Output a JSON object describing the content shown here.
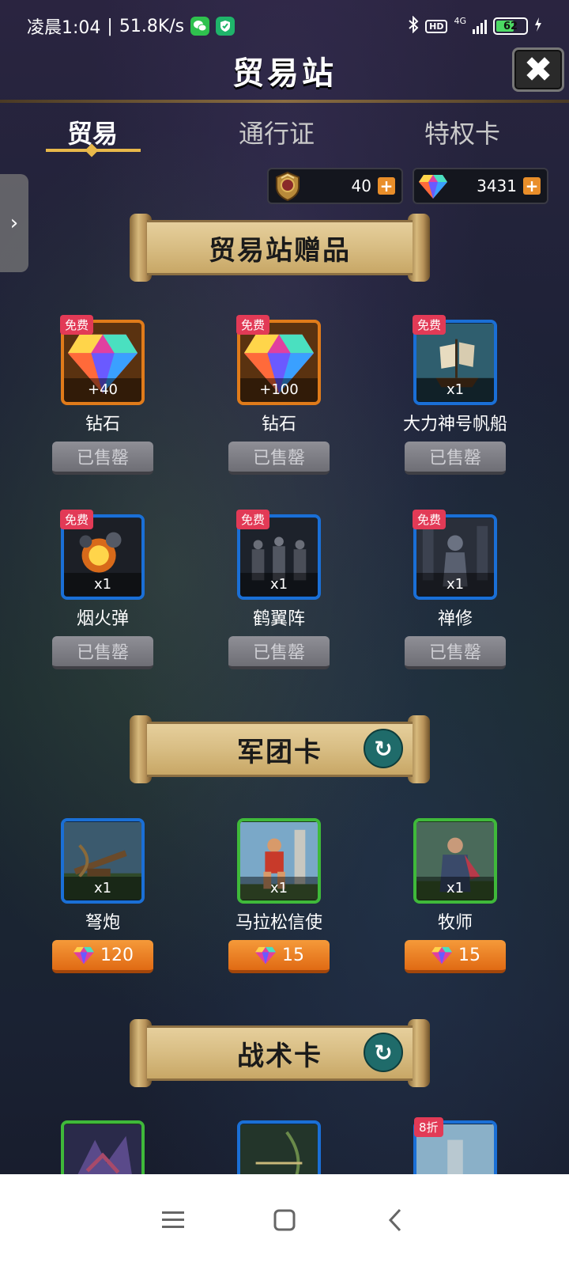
{
  "status_bar": {
    "time": "凌晨1:04",
    "speed": "51.8K/s",
    "network": "4G",
    "battery": "62",
    "battery_level": 0.62
  },
  "header": {
    "title": "贸易站",
    "close_icon": "close-icon"
  },
  "tabs": [
    {
      "label": "贸易",
      "active": true
    },
    {
      "label": "通行证",
      "active": false
    },
    {
      "label": "特权卡",
      "active": false
    }
  ],
  "currency": {
    "medal": {
      "icon": "medal-icon",
      "value": "40"
    },
    "diamond": {
      "icon": "diamond-icon",
      "value": "3431"
    }
  },
  "sections": {
    "gifts": {
      "title": "贸易站赠品",
      "items": [
        {
          "badge": "免费",
          "qty": "+40",
          "name": "钻石",
          "button": "已售罄",
          "icon": "diamond-icon"
        },
        {
          "badge": "免费",
          "qty": "+100",
          "name": "钻石",
          "button": "已售罄",
          "icon": "diamond-icon"
        },
        {
          "badge": "免费",
          "qty": "x1",
          "name": "大力神号帆船",
          "button": "已售罄",
          "icon": "ship-icon"
        },
        {
          "badge": "免费",
          "qty": "x1",
          "name": "烟火弹",
          "button": "已售罄",
          "icon": "explosion-icon"
        },
        {
          "badge": "免费",
          "qty": "x1",
          "name": "鹤翼阵",
          "button": "已售罄",
          "icon": "army-icon"
        },
        {
          "badge": "免费",
          "qty": "x1",
          "name": "禅修",
          "button": "已售罄",
          "icon": "monk-icon"
        }
      ]
    },
    "legion": {
      "title": "军团卡",
      "items": [
        {
          "qty": "x1",
          "name": "弩炮",
          "price": "120",
          "icon": "ballista-icon"
        },
        {
          "qty": "x1",
          "name": "马拉松信使",
          "price": "15",
          "icon": "runner-icon"
        },
        {
          "qty": "x1",
          "name": "牧师",
          "price": "15",
          "icon": "priest-icon"
        }
      ]
    },
    "tactics": {
      "title": "战术卡",
      "items": [
        {
          "badge": "",
          "icon": "dragon-icon"
        },
        {
          "badge": "",
          "icon": "archer-icon"
        },
        {
          "badge": "8折",
          "icon": "castle-icon"
        }
      ]
    }
  },
  "colors": {
    "accent": "#e8b84a",
    "free_badge": "#e23a56",
    "price_button": "#e98e2a",
    "rare_border": "#1a6fd6",
    "legend_border": "#e07b1a",
    "common_border": "#3fb93a"
  }
}
